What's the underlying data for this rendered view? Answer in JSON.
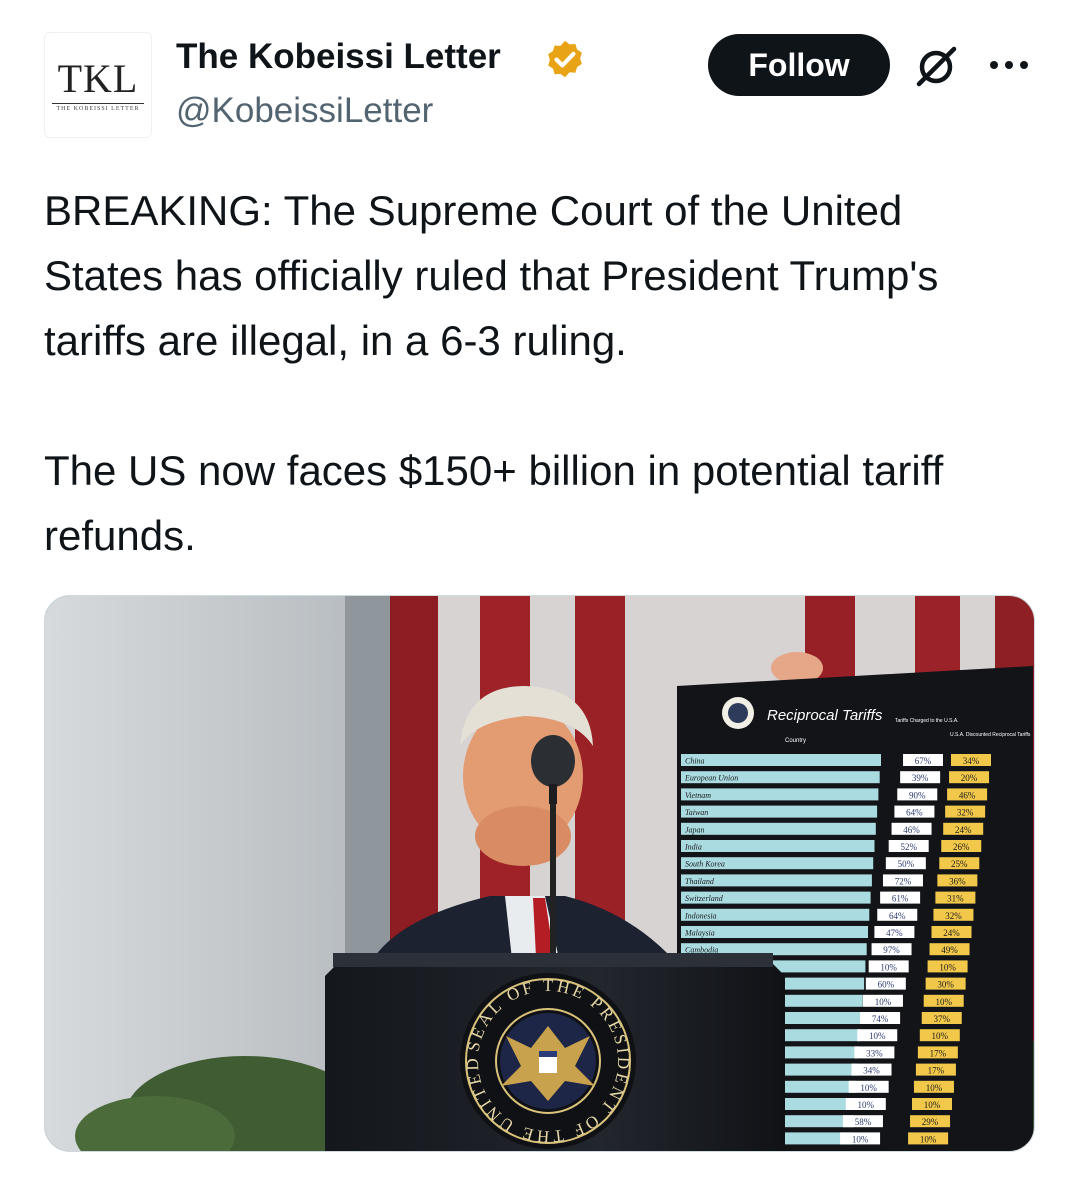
{
  "author": {
    "avatar_monogram": "TKL",
    "avatar_subtitle": "THE KOBEISSI LETTER",
    "display_name": "The Kobeissi Letter",
    "handle": "@KobeissiLetter",
    "verified_icon": "verified-badge-icon",
    "verified_color": "#e8a317"
  },
  "actions": {
    "follow_label": "Follow",
    "grok_icon": "grok-icon",
    "more_icon": "more-options-icon"
  },
  "tweet": {
    "paragraphs": [
      "BREAKING: The Supreme Court of the United States has officially ruled that President Trump's tariffs are illegal, in a 6-3 ruling.",
      "The US now faces $150+ billion in potential tariff refunds."
    ]
  },
  "media": {
    "board": {
      "title": "Reciprocal Tariffs",
      "col_country": "Country",
      "col_charged": "Tariffs Charged to the U.S.A.",
      "col_reciprocal": "U.S.A. Discounted Reciprocal Tariffs",
      "rows": [
        {
          "country": "China",
          "charged": "67%",
          "reciprocal": "34%"
        },
        {
          "country": "European Union",
          "charged": "39%",
          "reciprocal": "20%"
        },
        {
          "country": "Vietnam",
          "charged": "90%",
          "reciprocal": "46%"
        },
        {
          "country": "Taiwan",
          "charged": "64%",
          "reciprocal": "32%"
        },
        {
          "country": "Japan",
          "charged": "46%",
          "reciprocal": "24%"
        },
        {
          "country": "India",
          "charged": "52%",
          "reciprocal": "26%"
        },
        {
          "country": "South Korea",
          "charged": "50%",
          "reciprocal": "25%"
        },
        {
          "country": "Thailand",
          "charged": "72%",
          "reciprocal": "36%"
        },
        {
          "country": "Switzerland",
          "charged": "61%",
          "reciprocal": "31%"
        },
        {
          "country": "Indonesia",
          "charged": "64%",
          "reciprocal": "32%"
        },
        {
          "country": "Malaysia",
          "charged": "47%",
          "reciprocal": "24%"
        },
        {
          "country": "Cambodia",
          "charged": "97%",
          "reciprocal": "49%"
        },
        {
          "country": "",
          "charged": "10%",
          "reciprocal": "10%"
        },
        {
          "country": "",
          "charged": "60%",
          "reciprocal": "30%"
        },
        {
          "country": "",
          "charged": "10%",
          "reciprocal": "10%"
        },
        {
          "country": "",
          "charged": "74%",
          "reciprocal": "37%"
        },
        {
          "country": "",
          "charged": "10%",
          "reciprocal": "10%"
        },
        {
          "country": "",
          "charged": "33%",
          "reciprocal": "17%"
        },
        {
          "country": "",
          "charged": "34%",
          "reciprocal": "17%"
        },
        {
          "country": "",
          "charged": "10%",
          "reciprocal": "10%"
        },
        {
          "country": "",
          "charged": "10%",
          "reciprocal": "10%"
        },
        {
          "country": "",
          "charged": "58%",
          "reciprocal": "29%"
        },
        {
          "country": "",
          "charged": "10%",
          "reciprocal": "10%"
        }
      ]
    },
    "seal_text": "SEAL OF THE PRESIDENT OF THE UNITED STATES"
  }
}
